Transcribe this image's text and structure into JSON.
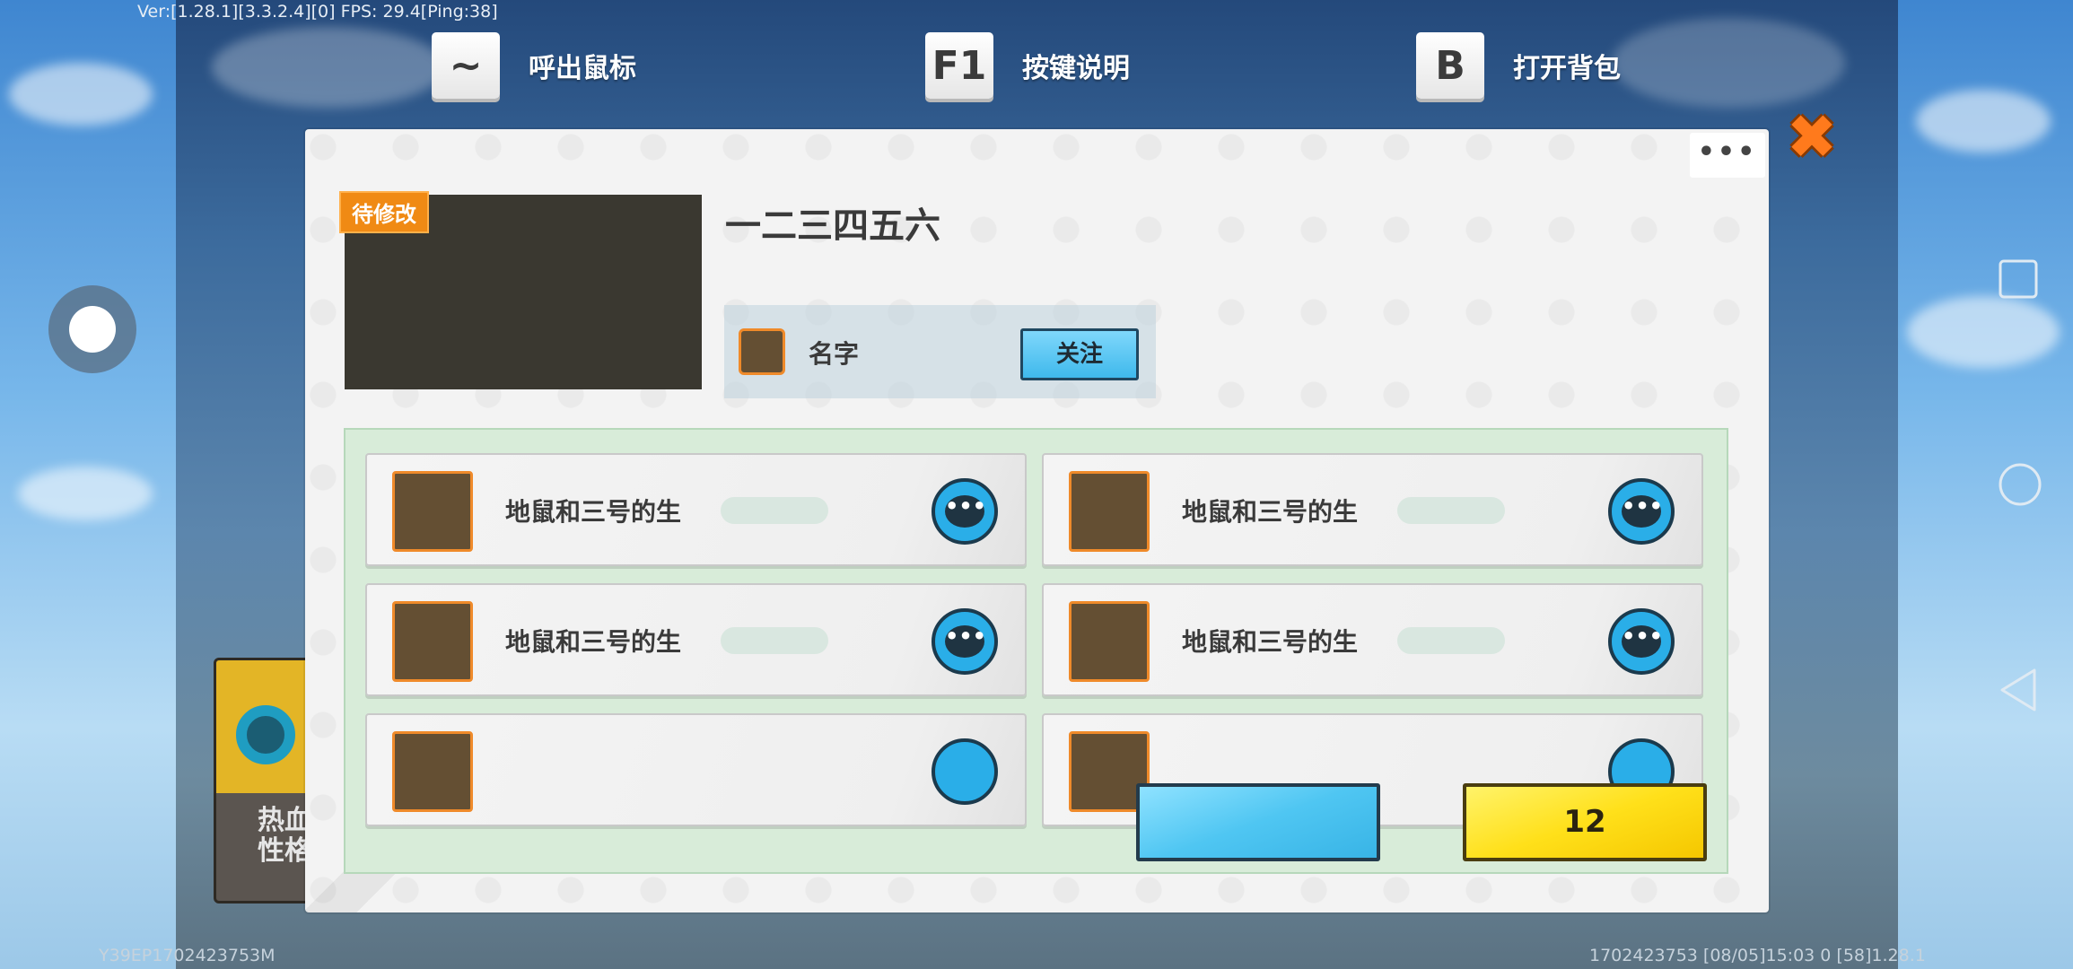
{
  "status": {
    "version": "Ver:[1.28.1][3.3.2.4][0] FPS: 29.4[Ping:38]",
    "device_id": "Y39EP1702423753M",
    "footer_info": "1702423753   [08/05]15:03 0   [58]1.28.1"
  },
  "hints": [
    {
      "key": "~",
      "label": "呼出鼠标",
      "icon": "tilde-key-icon"
    },
    {
      "key": "F1",
      "label": "按键说明"
    },
    {
      "key": "B",
      "label": "打开背包"
    }
  ],
  "side_card": {
    "label_line1": "热血",
    "label_line2": "性格"
  },
  "dialog": {
    "tag": "待修改",
    "title": "一二三四五六",
    "more": "•••",
    "author": {
      "name": "名字",
      "follow_label": "关注"
    },
    "items": [
      {
        "name": "地鼠和三号的生"
      },
      {
        "name": "地鼠和三号的生"
      },
      {
        "name": "地鼠和三号的生"
      },
      {
        "name": "地鼠和三号的生"
      }
    ],
    "primary_button_label": "",
    "coin_button_label": "12"
  },
  "colors": {
    "accent_orange": "#f08a14",
    "accent_blue": "#4fc6f2",
    "accent_yellow": "#ffe01a"
  }
}
